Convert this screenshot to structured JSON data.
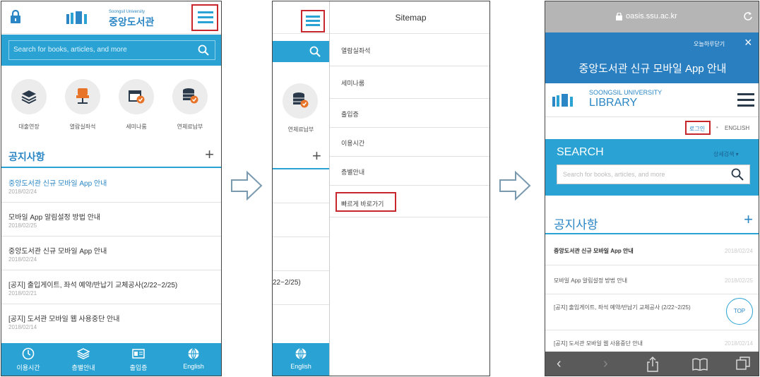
{
  "p1": {
    "logo_en": "Soongsil University",
    "logo_ko": "중앙도서관",
    "search_placeholder": "Search for books, articles, and more",
    "quick": [
      {
        "label": "대출연장",
        "icon": "books-icon"
      },
      {
        "label": "열람실좌석",
        "icon": "chair-icon"
      },
      {
        "label": "세미나룸",
        "icon": "calendar-icon"
      },
      {
        "label": "연체료납부",
        "icon": "database-icon"
      }
    ],
    "notice_title": "공지사항",
    "notices": [
      {
        "title": "중앙도서관 신규 모바일 App 안내",
        "date": "2018/02/24"
      },
      {
        "title": "모바일 App 알림설정 방법 안내",
        "date": "2018/02/25"
      },
      {
        "title": "중앙도서관 신규 모바일 App 안내",
        "date": "2018/02/24"
      },
      {
        "title": "[공지] 출입게이트, 좌석 예약/반납기 교체공사(2/22~2/25)",
        "date": "2018/02/21"
      },
      {
        "title": "[공지] 도서관 모바일 웹 사용중단 안내",
        "date": "2018/02/14"
      }
    ],
    "nav": [
      "이용시간",
      "층별안내",
      "출입증",
      "English"
    ],
    "colors": {
      "primary": "#2aa3d4",
      "link": "#2a86c4",
      "red": "#c8262d"
    }
  },
  "p2": {
    "sitemap_title": "Sitemap",
    "items": [
      "열람실좌석",
      "세미나룸",
      "출입증",
      "이용시간",
      "층별안내",
      "빠르게 바로가기"
    ],
    "left_label": "연체료납부",
    "partial_text": "22~2/25)",
    "nav_english": "English"
  },
  "p3": {
    "url": "oasis.ssu.ac.kr",
    "top_link": "오늘하루닫기",
    "banner": "중앙도서관 신규 모바일 App 안내",
    "brand_top": "SOONGSIL UNIVERSITY",
    "brand_bottom": "LIBRARY",
    "login": "로그인",
    "english": "ENGLISH",
    "search_title": "SEARCH",
    "search_option": "상세검색",
    "search_placeholder": "Search for books, articles, and more",
    "notice_title": "공지사항",
    "notices": [
      {
        "title": "중앙도서관 신규 모바일 App 안내",
        "date": "2018/02/24"
      },
      {
        "title": "모바일 App 알림설정 방법 안내",
        "date": "2018/02/25"
      },
      {
        "title": "[공지] 출입게이트, 좌석 예약/반납기 교체공사 (2/22~2/25)",
        "date": ""
      },
      {
        "title": "[공지] 도서관 모바일 웹 사용중단 안내",
        "date": "2018/02/14"
      }
    ],
    "top_button": "TOP"
  }
}
